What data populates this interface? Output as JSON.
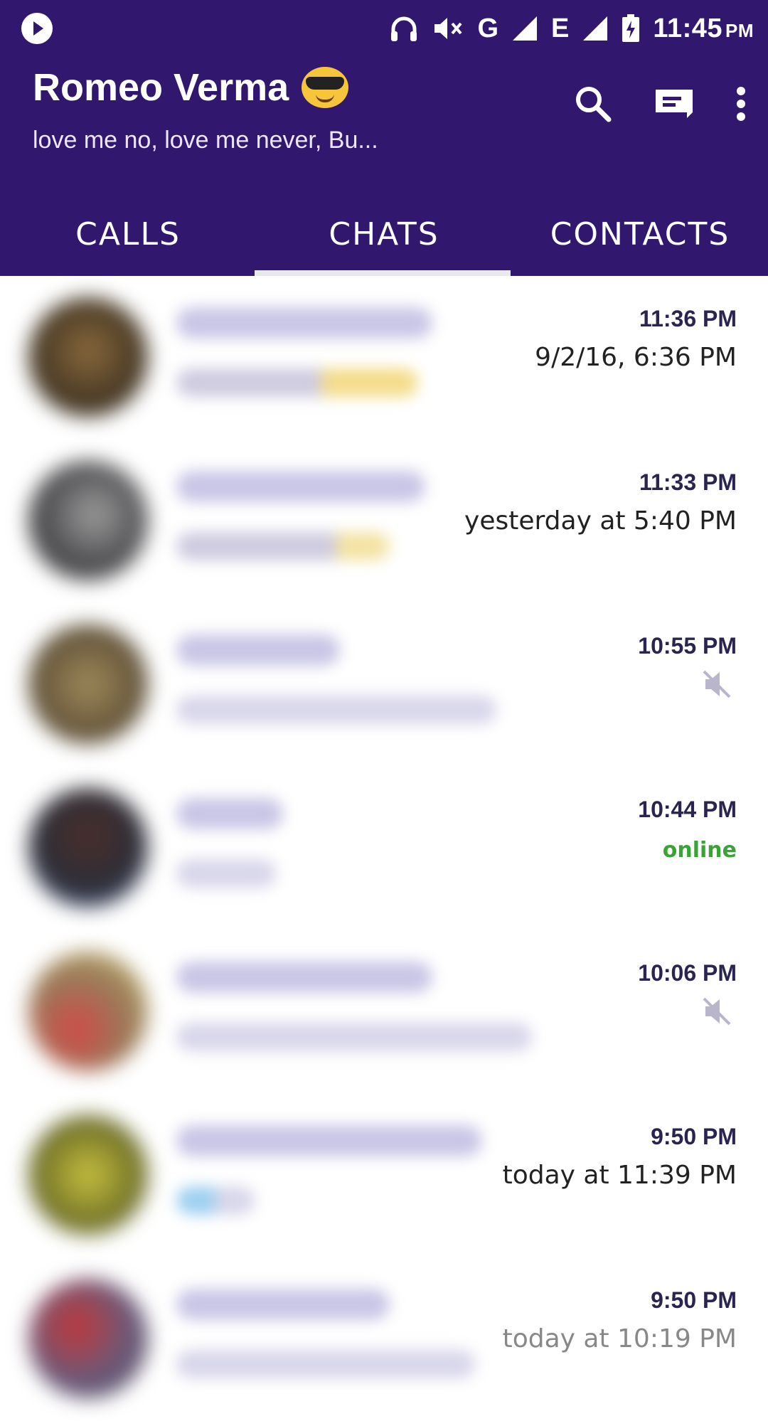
{
  "status_bar": {
    "time": "11:45",
    "ampm": "PM",
    "network_label": "G",
    "network_label_2": "E",
    "icons": [
      "app-play-icon",
      "headphones-icon",
      "volume-muted-icon",
      "signal-icon",
      "signal-icon",
      "battery-charging-icon"
    ]
  },
  "header": {
    "name": "Romeo Verma",
    "status": "love me no, love me never, Bu...",
    "actions": [
      "search-icon",
      "message-icon",
      "more-vert-icon"
    ]
  },
  "tabs": [
    {
      "label": "CALLS"
    },
    {
      "label": "CHATS",
      "selected": true
    },
    {
      "label": "CONTACTS"
    }
  ],
  "chats": [
    {
      "time": "11:36 PM",
      "sub": "9/2/16, 6:36 PM",
      "sub_type": "text"
    },
    {
      "time": "11:33 PM",
      "sub": "yesterday at 5:40 PM",
      "sub_type": "text"
    },
    {
      "time": "10:55 PM",
      "sub": "",
      "sub_type": "muted"
    },
    {
      "time": "10:44 PM",
      "sub": "online",
      "sub_type": "online"
    },
    {
      "time": "10:06 PM",
      "sub": "",
      "sub_type": "muted"
    },
    {
      "time": "9:50 PM",
      "sub": "today at 11:39 PM",
      "sub_type": "text"
    },
    {
      "time": "9:50 PM",
      "sub": "today at 10:19 PM",
      "sub_type": "text"
    }
  ],
  "colors": {
    "app_bar": "#31176e",
    "online": "#3aa335",
    "time_text": "#2a2450"
  }
}
